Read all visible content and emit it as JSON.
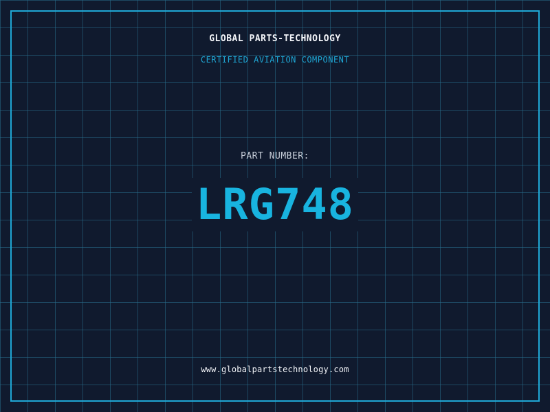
{
  "header": {
    "company": "GLOBAL PARTS-TECHNOLOGY",
    "subtitle": "CERTIFIED AVIATION COMPONENT"
  },
  "part": {
    "label": "PART NUMBER:",
    "number": "LRG748"
  },
  "footer": {
    "url": "www.globalpartstechnology.com"
  },
  "colors": {
    "background": "#101a2e",
    "grid": "#286e8c",
    "accent": "#1fa8d6",
    "part_number": "#18b4e0",
    "text": "#f2f4f8",
    "label": "#c7ced9"
  }
}
